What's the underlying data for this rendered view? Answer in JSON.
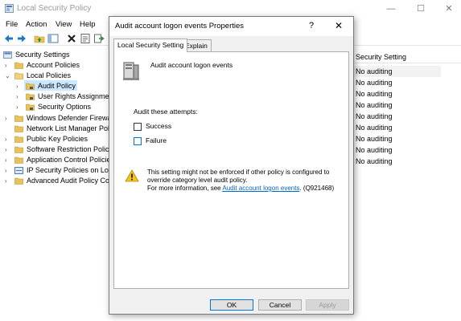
{
  "window": {
    "title": "Local Security Policy",
    "controls": {
      "minimize": "—",
      "maximize": "☐",
      "close": "✕"
    }
  },
  "menu": [
    "File",
    "Action",
    "View",
    "Help"
  ],
  "toolbar_icons": [
    "back-arrow-icon",
    "forward-arrow-icon",
    "up-folder-icon",
    "show-hide-tree-icon",
    "delete-icon",
    "properties-icon",
    "export-icon"
  ],
  "tree": [
    {
      "label": "Security Settings",
      "level": 0,
      "expand": "⌄"
    },
    {
      "label": "Account Policies",
      "level": 1,
      "expand": "›"
    },
    {
      "label": "Local Policies",
      "level": 1,
      "expand": "⌄"
    },
    {
      "label": "Audit Policy",
      "level": 2,
      "expand": "›",
      "selected": true
    },
    {
      "label": "User Rights Assignment",
      "level": 2,
      "expand": "›"
    },
    {
      "label": "Security Options",
      "level": 2,
      "expand": "›"
    },
    {
      "label": "Windows Defender Firewall",
      "level": 1,
      "expand": "›"
    },
    {
      "label": "Network List Manager Policies",
      "level": 1,
      "expand": ""
    },
    {
      "label": "Public Key Policies",
      "level": 1,
      "expand": "›"
    },
    {
      "label": "Software Restriction Policies",
      "level": 1,
      "expand": "›"
    },
    {
      "label": "Application Control Policies",
      "level": 1,
      "expand": "›"
    },
    {
      "label": "IP Security Policies on Local",
      "level": 1,
      "expand": "›"
    },
    {
      "label": "Advanced Audit Policy Configuration",
      "level": 1,
      "expand": "›"
    }
  ],
  "list": {
    "column_header": "Security Setting",
    "rows": [
      "No auditing",
      "No auditing",
      "No auditing",
      "No auditing",
      "No auditing",
      "No auditing",
      "No auditing",
      "No auditing",
      "No auditing"
    ]
  },
  "dialog": {
    "title": "Audit account logon events Properties",
    "help": "?",
    "close": "✕",
    "tabs": [
      "Local Security Setting",
      "Explain"
    ],
    "policy_name": "Audit account logon events",
    "attempts_label": "Audit these attempts:",
    "success_label": "Success",
    "failure_label": "Failure",
    "success_checked": false,
    "failure_checked": false,
    "warning_line1": "This setting might not be enforced if other policy is configured to override category level audit policy.",
    "warning_prefix": "For more information, see ",
    "warning_link": "Audit account logon events",
    "warning_suffix": ". (Q921468)",
    "buttons": {
      "ok": "OK",
      "cancel": "Cancel",
      "apply": "Apply"
    }
  },
  "colors": {
    "selection": "#cce8ff",
    "link": "#0066cc",
    "accent": "#0078d7",
    "folder": "#e8c25a"
  }
}
